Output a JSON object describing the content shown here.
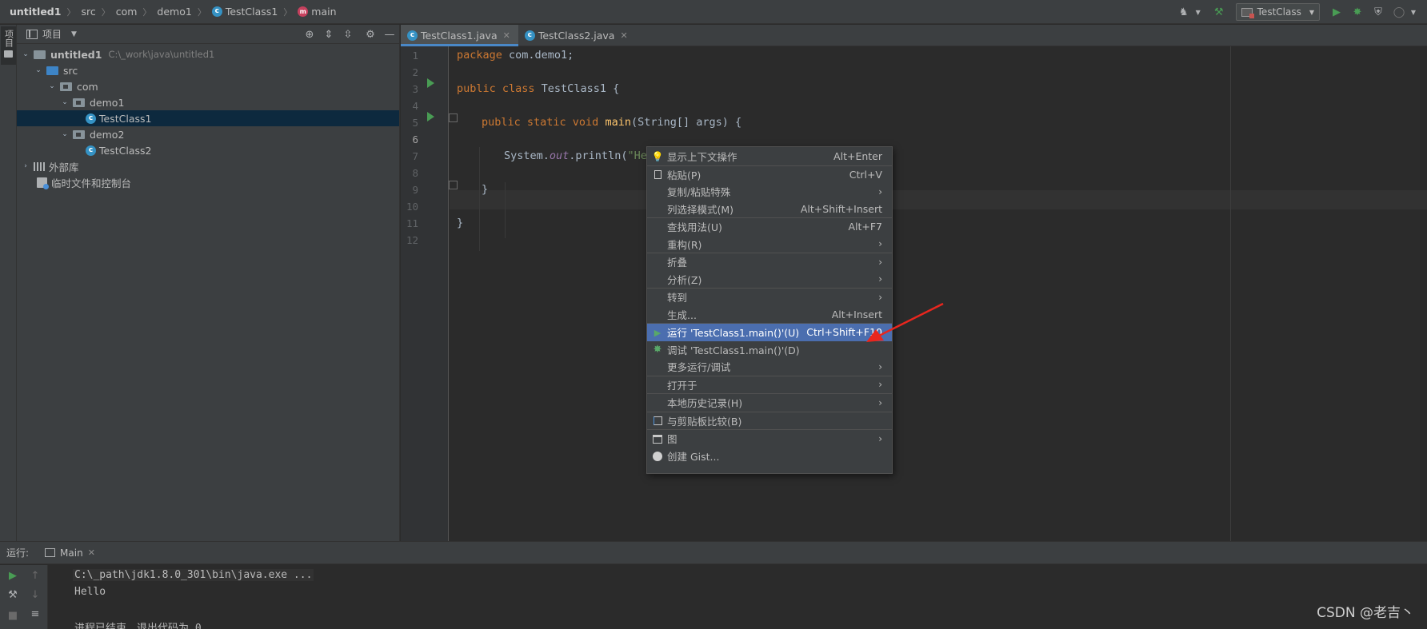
{
  "breadcrumb": {
    "items": [
      "untitled1",
      "src",
      "com",
      "demo1",
      "TestClass1",
      "main"
    ]
  },
  "toolbar": {
    "run_config": "TestClass"
  },
  "left_stripe": {
    "project_tab": "项目"
  },
  "project_panel": {
    "title": "项目",
    "tree": [
      {
        "label": "untitled1",
        "path": "C:\\_work\\java\\untitled1"
      },
      {
        "label": "src"
      },
      {
        "label": "com"
      },
      {
        "label": "demo1"
      },
      {
        "label": "TestClass1"
      },
      {
        "label": "demo2"
      },
      {
        "label": "TestClass2"
      },
      {
        "label": "外部库"
      },
      {
        "label": "临时文件和控制台"
      }
    ]
  },
  "editor": {
    "tabs": [
      {
        "label": "TestClass1.java"
      },
      {
        "label": "TestClass2.java"
      }
    ],
    "line_numbers": [
      "1",
      "2",
      "3",
      "4",
      "5",
      "6",
      "7",
      "8",
      "9",
      "10",
      "11",
      "12"
    ],
    "code": {
      "l1_kw": "package",
      "l1_rest": " com.demo1;",
      "l3_kw": "public class",
      "l3_rest": " TestClass1 {",
      "l5_kw": "public static void",
      "l5_fn": "main",
      "l5_rest": "(String[] args) {",
      "l7_a": "System.",
      "l7_fld": "out",
      "l7_b": ".println(",
      "l7_str": "\"He",
      "l9": "}",
      "l11": "}"
    }
  },
  "context_menu": {
    "items": [
      {
        "label": "显示上下文操作",
        "shortcut": "Alt+Enter"
      },
      {
        "label": "粘贴(P)",
        "shortcut": "Ctrl+V"
      },
      {
        "label": "复制/粘贴特殊",
        "submenu": true
      },
      {
        "label": "列选择模式(M)",
        "shortcut": "Alt+Shift+Insert"
      },
      {
        "label": "查找用法(U)",
        "shortcut": "Alt+F7"
      },
      {
        "label": "重构(R)",
        "submenu": true
      },
      {
        "label": "折叠",
        "submenu": true
      },
      {
        "label": "分析(Z)",
        "submenu": true
      },
      {
        "label": "转到",
        "submenu": true
      },
      {
        "label": "生成...",
        "shortcut": "Alt+Insert"
      },
      {
        "label": "运行 'TestClass1.main()'(U)",
        "shortcut": "Ctrl+Shift+F10"
      },
      {
        "label": "调试 'TestClass1.main()'(D)"
      },
      {
        "label": "更多运行/调试",
        "submenu": true
      },
      {
        "label": "打开于",
        "submenu": true
      },
      {
        "label": "本地历史记录(H)",
        "submenu": true
      },
      {
        "label": "与剪贴板比较(B)"
      },
      {
        "label": "图",
        "submenu": true
      },
      {
        "label": "创建 Gist..."
      }
    ],
    "submenu_glyph": "›"
  },
  "run_panel": {
    "label": "运行:",
    "tab": "Main",
    "console": [
      "C:\\_path\\jdk1.8.0_301\\bin\\java.exe ...",
      "Hello",
      "进程已结束，退出代码为 0"
    ]
  },
  "watermark": "CSDN @老吉丶",
  "colors": {
    "accent": "#4b6eaf",
    "run_green": "#499c54",
    "keyword": "#cc7832",
    "annotation_red": "#e8261e"
  }
}
